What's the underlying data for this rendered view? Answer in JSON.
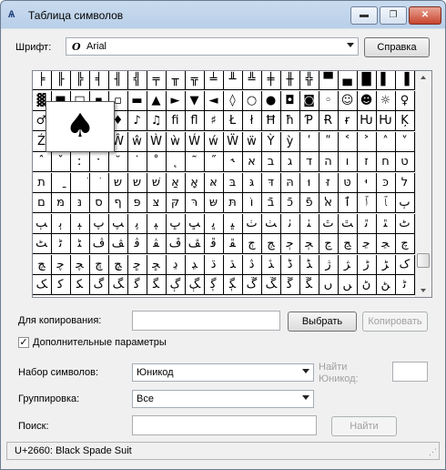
{
  "window": {
    "title": "Таблица символов",
    "app_icon": "Ѧ",
    "minimize": "▬",
    "maximize": "❐",
    "close": "✕"
  },
  "font_row": {
    "label": "Шрифт:",
    "font_glyph": "O",
    "font_value": "Arial",
    "help_button": "Справка"
  },
  "grid": {
    "columns": 20,
    "selected_zoom": "♠",
    "rows": [
      [
        "╞",
        "╟",
        "╠",
        "╡",
        "╢",
        "╣",
        "╤",
        "╥",
        "╦",
        "╧",
        "╨",
        "╩",
        "╪",
        "╫",
        "╬",
        "▀",
        "▄",
        "█",
        "▌",
        "▐"
      ],
      [
        "▓",
        "■",
        "□",
        "▪",
        "▫",
        "▬",
        "▲",
        "►",
        "▼",
        "◄",
        "◊",
        "○",
        "●",
        "◘",
        "◙",
        "◦",
        "☺",
        "☻",
        "☼",
        "♀"
      ],
      [
        "♂",
        "♠",
        "♣",
        "♥",
        "♦",
        "♪",
        "♫",
        "ﬁ",
        "ﬂ",
        "♯",
        "Ł",
        "ł",
        "Ħ",
        "ħ",
        "Ƥ",
        "Ɍ",
        "ɍ",
        "Ƕ",
        "Ƕ",
        "Ķ"
      ],
      [
        "Ź",
        "ź",
        "Ż",
        "ż",
        "Ŵ",
        "ŵ",
        "Ẁ",
        "ẁ",
        "Ẃ",
        "ẃ",
        "Ẅ",
        "ẅ",
        "Ỳ",
        "ỳ",
        "ʹ",
        "ʺ",
        "˂",
        "˃",
        "˄",
        "˅"
      ],
      [
        "ˆ",
        "ˇ",
        "ː",
        "ˑ",
        "˘",
        "˙",
        "˚",
        "˛",
        "˜",
        "˝",
        "˞",
        "א",
        "ב",
        "ג",
        "ד",
        "ה",
        "ו",
        "ז",
        "ח",
        "ט"
      ],
      [
        "ת",
        "ַ",
        "ׁ",
        "ׂ",
        "ש",
        "ש",
        "שׁ",
        "אַ",
        "אָ",
        "אּ",
        "בּ",
        "גּ",
        "דּ",
        "הּ",
        "וּ",
        "זּ",
        "טּ",
        "יּ",
        "כּ",
        "ל"
      ],
      [
        "ם",
        "מּ",
        "נּ",
        "ס",
        "ף",
        "פּ",
        "צּ",
        "קּ",
        "רּ",
        "שּ",
        "תּ",
        "וֹ",
        "בֿ",
        "כֿ",
        "פֿ",
        "ﭏ",
        "ٱ",
        "ﭐ",
        "ﭑ",
        "ﭒ"
      ],
      [
        "ﭓ",
        "ﭔ",
        "ﭕ",
        "ﭖ",
        "ﭗ",
        "ﭘ",
        "ﭙ",
        "ﭚ",
        "ﭛ",
        "ﭜ",
        "ﭝ",
        "ﭞ",
        "ﭟ",
        "ﭠ",
        "ﭡ",
        "ﭢ",
        "ﭣ",
        "ﭤ",
        "ﭥ",
        "ﭦ"
      ],
      [
        "ﭧ",
        "ﭨ",
        "ﭩ",
        "ﭪ",
        "ﭫ",
        "ﭬ",
        "ﭭ",
        "ﭮ",
        "ﭯ",
        "ﭰ",
        "ﭱ",
        "ﭲ",
        "ﭳ",
        "ﭴ",
        "ﭵ",
        "ﭶ",
        "ﭷ",
        "ﭸ",
        "ﭹ",
        "ﭺ"
      ],
      [
        "ﭻ",
        "ﭼ",
        "ﭽ",
        "ﭾ",
        "ﭿ",
        "ﮀ",
        "ﮁ",
        "ﮂ",
        "ﮃ",
        "ﮄ",
        "ﮅ",
        "ﮆ",
        "ﮇ",
        "ﮈ",
        "ﮉ",
        "ﮊ",
        "ﮋ",
        "ﮌ",
        "ﮍ",
        "ﮎ"
      ],
      [
        "ﮏ",
        "ﮐ",
        "ﮑ",
        "ﮒ",
        "ﮓ",
        "ﮔ",
        "ﮕ",
        "ﮖ",
        "ﮗ",
        "ﮘ",
        "ﮙ",
        "ﮚ",
        "ﮛ",
        "ﮜ",
        "ﮝ",
        "ﮞ",
        "ﮟ",
        "ﮠ",
        "ﮡ",
        "ﮢ"
      ]
    ]
  },
  "copy_row": {
    "label": "Для копирования:",
    "value": "",
    "select_button": "Выбрать",
    "copy_button": "Копировать"
  },
  "advanced": {
    "checkbox_mark": "✓",
    "label": "Дополнительные параметры"
  },
  "charset": {
    "label": "Набор символов:",
    "value": "Юникод",
    "goto_label_1": "Найти",
    "goto_label_2": "Юникод:",
    "goto_value": ""
  },
  "grouping": {
    "label": "Группировка:",
    "value": "Все"
  },
  "search": {
    "label": "Поиск:",
    "value": "",
    "find_button": "Найти"
  },
  "status": {
    "text": "U+2660: Black Spade Suit"
  }
}
